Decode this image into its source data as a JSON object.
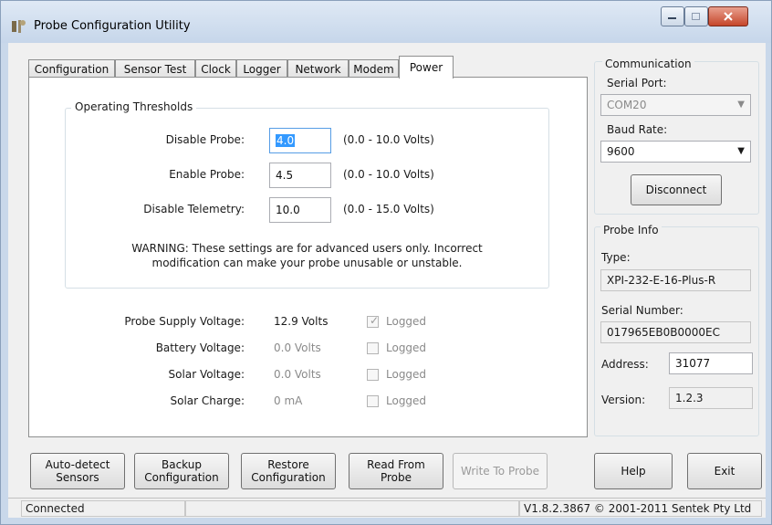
{
  "window": {
    "title": "Probe Configuration Utility"
  },
  "tabs": [
    "Configuration",
    "Sensor Test",
    "Clock",
    "Logger",
    "Network",
    "Modem",
    "Power"
  ],
  "active_tab": "Power",
  "thresholds": {
    "group_title": "Operating Thresholds",
    "rows": [
      {
        "label": "Disable Probe:",
        "value": "4.0",
        "range": "(0.0 - 10.0 Volts)"
      },
      {
        "label": "Enable Probe:",
        "value": "4.5",
        "range": "(0.0 - 10.0 Volts)"
      },
      {
        "label": "Disable Telemetry:",
        "value": "10.0",
        "range": "(0.0 - 15.0 Volts)"
      }
    ],
    "warning_line1": "WARNING: These settings are for advanced users only. Incorrect",
    "warning_line2": "modification can make your probe unusable or unstable."
  },
  "readings": [
    {
      "label": "Probe Supply Voltage:",
      "value": "12.9 Volts",
      "logged_label": "Logged",
      "logged": true
    },
    {
      "label": "Battery Voltage:",
      "value": "0.0 Volts",
      "logged_label": "Logged",
      "logged": false
    },
    {
      "label": "Solar Voltage:",
      "value": "0.0 Volts",
      "logged_label": "Logged",
      "logged": false
    },
    {
      "label": "Solar Charge:",
      "value": "0 mA",
      "logged_label": "Logged",
      "logged": false
    }
  ],
  "communication": {
    "title": "Communication",
    "serial_port_label": "Serial Port:",
    "serial_port_value": "COM20",
    "baud_rate_label": "Baud Rate:",
    "baud_rate_value": "9600",
    "disconnect_label": "Disconnect"
  },
  "probe_info": {
    "title": "Probe Info",
    "type_label": "Type:",
    "type_value": "XPI-232-E-16-Plus-R",
    "serial_label": "Serial Number:",
    "serial_value": "017965EB0B0000EC",
    "address_label": "Address:",
    "address_value": "31077",
    "version_label": "Version:",
    "version_value": "1.2.3"
  },
  "buttons": {
    "autodetect_line1": "Auto-detect",
    "autodetect_line2": "Sensors",
    "backup_line1": "Backup",
    "backup_line2": "Configuration",
    "restore_line1": "Restore",
    "restore_line2": "Configuration",
    "read_line1": "Read From",
    "read_line2": "Probe",
    "write": "Write To Probe",
    "help": "Help",
    "exit": "Exit"
  },
  "status": {
    "connection": "Connected",
    "version": "V1.8.2.3867 © 2001-2011 Sentek Pty Ltd"
  },
  "colors": {
    "selection": "#3399ff",
    "titlebar": "#c6d6ea",
    "close_button": "#c5462b"
  }
}
